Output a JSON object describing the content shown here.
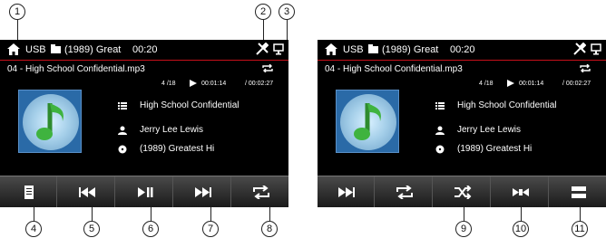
{
  "callouts": [
    "1",
    "2",
    "3",
    "4",
    "5",
    "6",
    "7",
    "8",
    "9",
    "10",
    "11"
  ],
  "screens": [
    {
      "topbar": {
        "source": "USB",
        "album": "(1989) Great",
        "time": "00:20"
      },
      "filename": "04 - High School Confidential.mp3",
      "progress": {
        "track_count": "4 /18",
        "current": "00:01:14",
        "total": "/ 00:02:27"
      },
      "info": {
        "title": "High School Confidential",
        "artist": "Jerry Lee Lewis",
        "album": "(1989) Greatest Hi"
      },
      "controls": [
        "list-icon",
        "previous-icon",
        "play-pause-icon",
        "next-icon",
        "repeat-icon"
      ]
    },
    {
      "topbar": {
        "source": "USB",
        "album": "(1989) Great",
        "time": "00:20"
      },
      "filename": "04 - High School Confidential.mp3",
      "progress": {
        "track_count": "4 /18",
        "current": "00:01:14",
        "total": "/ 00:02:27"
      },
      "info": {
        "title": "High School Confidential",
        "artist": "Jerry Lee Lewis",
        "album": "(1989) Greatest Hi"
      },
      "controls": [
        "next-page-icon",
        "repeat-icon",
        "shuffle-icon",
        "equalizer-icon",
        "menu-icon"
      ]
    }
  ],
  "colors": {
    "accent_line": "#c8101a",
    "screen_bg": "#000000",
    "button_bar": "#2a2a2a"
  }
}
